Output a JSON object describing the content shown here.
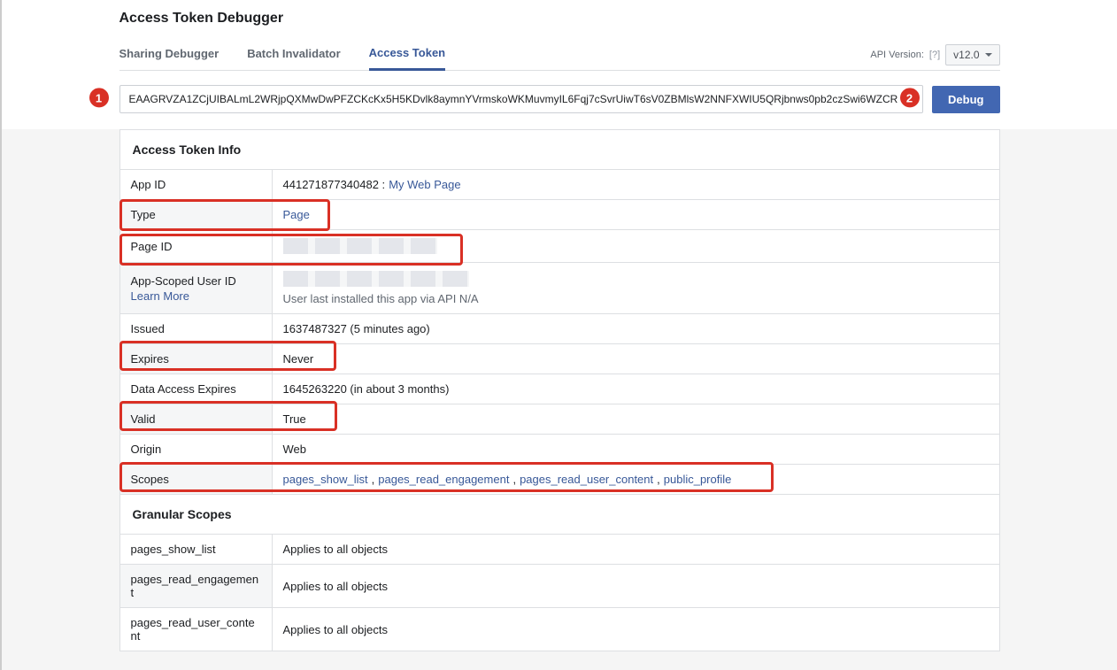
{
  "header": {
    "title": "Access Token Debugger",
    "tabs": [
      {
        "label": "Sharing Debugger",
        "active": false
      },
      {
        "label": "Batch Invalidator",
        "active": false
      },
      {
        "label": "Access Token",
        "active": true
      }
    ],
    "api_version_label": "API Version:",
    "api_version_help": "[?]",
    "api_version_value": "v12.0"
  },
  "badges": {
    "one": "1",
    "two": "2"
  },
  "token_input": "EAAGRVZA1ZCjUIBALmL2WRjpQXMwDwPFZCKcKx5H5KDvlk8aymnYVrmskoWKMuvmyIL6Fqj7cSvrUiwT6sV0ZBMlsW2NNFXWIU5QRjbnws0pb2czSwi6WZCR",
  "debug_button": "Debug",
  "info_header": "Access Token Info",
  "rows": {
    "app_id_label": "App ID",
    "app_id_value": "441271877340482 : ",
    "app_id_link": "My Web Page",
    "type_label": "Type",
    "type_value": "Page",
    "page_id_label": "Page ID",
    "scoped_user_label": "App-Scoped User ID",
    "learn_more": "Learn More",
    "scoped_user_note": "User last installed this app via API N/A",
    "issued_label": "Issued",
    "issued_value": "1637487327 (5 minutes ago)",
    "expires_label": "Expires",
    "expires_value": "Never",
    "data_expires_label": "Data Access Expires",
    "data_expires_value": "1645263220 (in about 3 months)",
    "valid_label": "Valid",
    "valid_value": "True",
    "origin_label": "Origin",
    "origin_value": "Web",
    "scopes_label": "Scopes",
    "scopes": [
      "pages_show_list",
      "pages_read_engagement",
      "pages_read_user_content",
      "public_profile"
    ]
  },
  "granular_header": "Granular Scopes",
  "granular": [
    {
      "key": "pages_show_list",
      "val": "Applies to all objects"
    },
    {
      "key": "pages_read_engagement",
      "val": "Applies to all objects"
    },
    {
      "key": "pages_read_user_content",
      "val": "Applies to all objects"
    }
  ]
}
